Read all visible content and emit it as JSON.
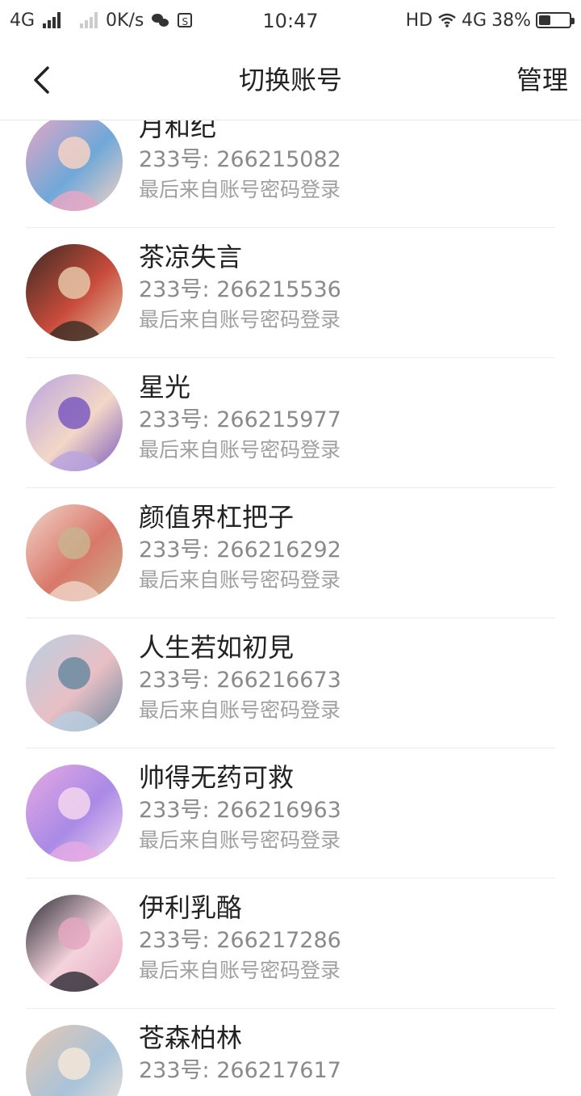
{
  "status_bar": {
    "network_left": "4G",
    "speed": "0K/s",
    "time": "10:47",
    "hd": "HD",
    "network_right": "4G",
    "battery": "38%",
    "battery_level": 0.38
  },
  "nav": {
    "title": "切换账号",
    "manage": "管理",
    "back_icon": "chevron-left-icon"
  },
  "accounts": [
    {
      "name": "月和纪",
      "uid_label": "233号:",
      "uid": "266215082",
      "source": "最后来自账号密码登录",
      "colors": [
        "#e9a6c6",
        "#6fa8d8",
        "#f7d2c4"
      ]
    },
    {
      "name": "茶凉失言",
      "uid_label": "233号:",
      "uid": "266215536",
      "source": "最后来自账号密码登录",
      "colors": [
        "#3a2a22",
        "#c84b3c",
        "#e6c7a8"
      ]
    },
    {
      "name": "星光",
      "uid_label": "233号:",
      "uid": "266215977",
      "source": "最后来自账号密码登录",
      "colors": [
        "#b8a4e0",
        "#f3d7c7",
        "#7b5bbf"
      ]
    },
    {
      "name": "颜值界杠把子",
      "uid_label": "233号:",
      "uid": "266216292",
      "source": "最后来自账号密码登录",
      "colors": [
        "#f0d4c8",
        "#d9786a",
        "#c9b38f"
      ]
    },
    {
      "name": "人生若如初見",
      "uid_label": "233号:",
      "uid": "266216673",
      "source": "最后来自账号密码登录",
      "colors": [
        "#b8cfe2",
        "#e9bfc5",
        "#6b8aa0"
      ]
    },
    {
      "name": "帅得无药可救",
      "uid_label": "233号:",
      "uid": "266216963",
      "source": "最后来自账号密码登录",
      "colors": [
        "#e6a9e3",
        "#a98ae6",
        "#f5d6ef"
      ]
    },
    {
      "name": "伊利乳酪",
      "uid_label": "233号:",
      "uid": "266217286",
      "source": "最后来自账号密码登录",
      "colors": [
        "#2b2b33",
        "#f4d3dc",
        "#e4a7c0"
      ]
    },
    {
      "name": "苍森柏林",
      "uid_label": "233号:",
      "uid": "266217617",
      "source": "",
      "colors": [
        "#e8c7b2",
        "#a8c3d9",
        "#f5e6d8"
      ]
    }
  ]
}
